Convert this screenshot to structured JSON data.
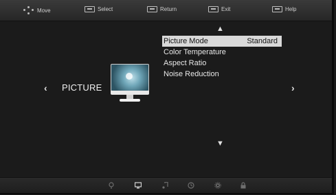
{
  "hints": [
    {
      "icon": "dpad-icon",
      "label": "Move"
    },
    {
      "icon": "ok-key-icon",
      "label": "Select"
    },
    {
      "icon": "menu-key-icon",
      "label": "Return"
    },
    {
      "icon": "exit-key-icon",
      "label": "Exit"
    },
    {
      "icon": "info-key-icon",
      "label": "Help"
    }
  ],
  "category": {
    "title": "PICTURE",
    "icon": "tv-monitor-icon",
    "prev_arrow": "‹",
    "next_arrow": "›"
  },
  "menu": {
    "scroll_up": "▲",
    "scroll_down": "▼",
    "items": [
      {
        "label": "Picture Mode",
        "value": "Standard",
        "selected": true
      },
      {
        "label": "Color Temperature",
        "value": ""
      },
      {
        "label": "Aspect Ratio",
        "value": ""
      },
      {
        "label": "Noise Reduction",
        "value": ""
      }
    ]
  },
  "bottom_icons": [
    "satellite-icon",
    "picture-icon",
    "music-note-icon",
    "clock-icon",
    "gear-icon",
    "lock-icon"
  ],
  "active_bottom_icon": "picture-icon",
  "colors": {
    "background": "#1b1b1b",
    "highlight": "#d9d9d9",
    "text": "#e8e8e8"
  }
}
